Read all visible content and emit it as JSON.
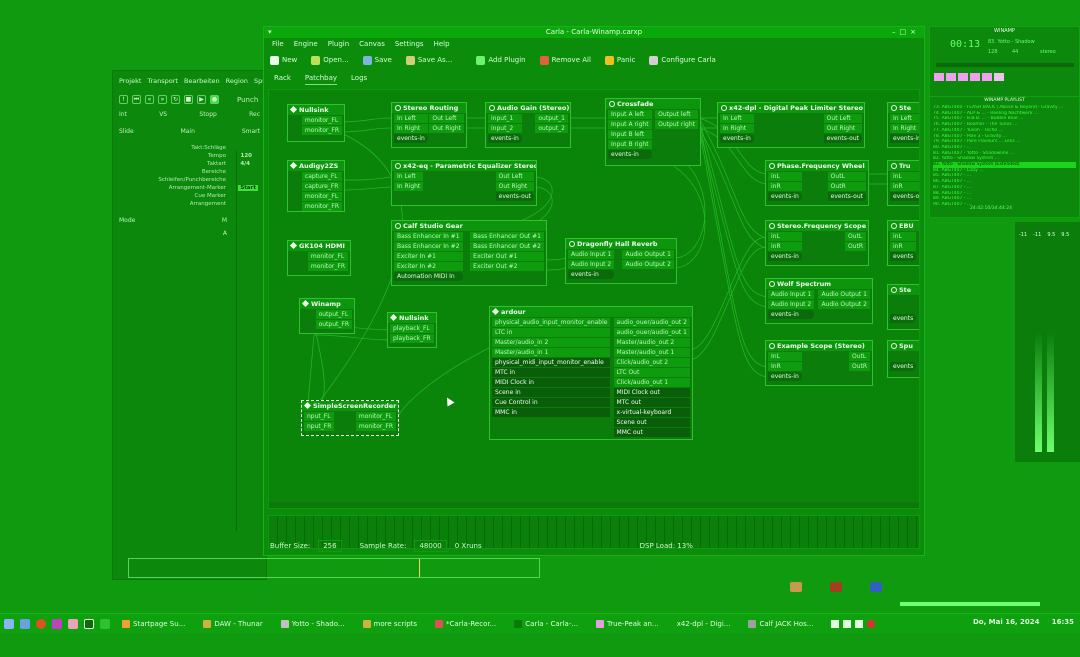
{
  "daw": {
    "menu": [
      "Projekt",
      "Transport",
      "Bearbeiten",
      "Region",
      "Spur"
    ],
    "punch_label": "Punch",
    "int_label": "Int",
    "vs_label": "VS",
    "stopp_label": "Stopp",
    "rec_label": "Rec",
    "slide_label": "Slide",
    "main_label": "Main",
    "smart_label": "Smart",
    "rulers": [
      "Takt:Schläge",
      "Tempo",
      "Taktart",
      "Bereiche",
      "Schleifen/Punchbereiche",
      "Arrangement-Marker",
      "Cue Marker",
      "Arrangement"
    ],
    "tempo_value": "120",
    "meter_value": "4/4",
    "start_label": "Start",
    "mode_label": "Mode",
    "m_label": "M",
    "a_label": "A"
  },
  "carla": {
    "title": "Carla - Carla-Winamp.carxp",
    "menu": [
      "File",
      "Engine",
      "Plugin",
      "Canvas",
      "Settings",
      "Help"
    ],
    "toolbar": [
      "New",
      "Open...",
      "Save",
      "Save As...",
      "Add Plugin",
      "Remove All",
      "Panic",
      "Configure Carla"
    ],
    "tabs": [
      "Rack",
      "Patchbay",
      "Logs"
    ],
    "status": {
      "buffer_label": "Buffer Size:",
      "buffer_value": "256",
      "rate_label": "Sample Rate:",
      "rate_value": "48000",
      "xruns": "0 Xruns",
      "dsp": "DSP Load: 13%"
    },
    "plugins": {
      "nullsink1": {
        "title": "Nullsink",
        "out": [
          "monitor_FL",
          "monitor_FR"
        ]
      },
      "stereo_routing": {
        "title": "Stereo Routing",
        "in": [
          "In Left",
          "In Right",
          "events-in"
        ],
        "out": [
          "Out Left",
          "Out Right"
        ]
      },
      "audio_gain": {
        "title": "Audio Gain (Stereo)",
        "in": [
          "input_1",
          "input_2",
          "events-in"
        ],
        "out": [
          "output_1",
          "output_2"
        ]
      },
      "crossfade": {
        "title": "Crossfade",
        "in": [
          "Input A left",
          "Input A right",
          "Input B left",
          "Input B right",
          "events-in"
        ],
        "out": [
          "Output left",
          "Output right"
        ]
      },
      "x42_dpl": {
        "title": "x42-dpl - Digital Peak Limiter Stereo",
        "in": [
          "In Left",
          "In Right",
          "events-in"
        ],
        "out": [
          "Out Left",
          "Out Right",
          "events-out"
        ]
      },
      "ste_cut": {
        "title": "Ste",
        "in": [
          "In Left",
          "In Right",
          "events-in"
        ]
      },
      "audigy": {
        "title": "Audigy2ZS",
        "out": [
          "capture_FL",
          "capture_FR",
          "monitor_FL",
          "monitor_FR"
        ]
      },
      "x42_eq": {
        "title": "x42-eq - Parametric Equalizer Stereo",
        "in": [
          "In Left",
          "In Right"
        ],
        "out": [
          "Out Left",
          "Out Right",
          "events-out"
        ]
      },
      "phase_wheel": {
        "title": "Phase.Frequency Wheel",
        "in": [
          "inL",
          "inR",
          "events-in"
        ],
        "out": [
          "OutL",
          "OutR",
          "events-out"
        ]
      },
      "tru_cut": {
        "title": "Tru",
        "in": [
          "inL",
          "inR",
          "events-o"
        ]
      },
      "calf_gear": {
        "title": "Calf Studio Gear",
        "in": [
          "Bass Enhancer In #1",
          "Bass Enhancer In #2",
          "Exciter In #1",
          "Exciter In #2",
          "Automation MIDI In"
        ],
        "out": [
          "Bass Enhancer Out #1",
          "Bass Enhancer Out #2",
          "Exciter Out #1",
          "Exciter Out #2"
        ]
      },
      "gk104": {
        "title": "GK104 HDMI",
        "out": [
          "monitor_FL",
          "monitor_FR"
        ]
      },
      "dragonfly": {
        "title": "Dragonfly Hall Reverb",
        "in": [
          "Audio Input 1",
          "Audio Input 2",
          "events-in"
        ],
        "out": [
          "Audio Output 1",
          "Audio Output 2"
        ]
      },
      "stereo_scope": {
        "title": "Stereo.Frequency Scope",
        "in": [
          "inL",
          "inR",
          "events-in"
        ],
        "out": [
          "OutL",
          "OutR"
        ]
      },
      "ebu_cut": {
        "title": "EBU",
        "in": [
          "inL",
          "inR",
          "events"
        ]
      },
      "wolf": {
        "title": "Wolf Spectrum",
        "in": [
          "Audio Input 1",
          "Audio Input 2",
          "events-in"
        ],
        "out": [
          "Audio Output 1",
          "Audio Output 2"
        ]
      },
      "ste2_cut": {
        "title": "Ste",
        "in": [
          "events"
        ]
      },
      "winamp": {
        "title": "Winamp",
        "out": [
          "output_FL",
          "output_FR"
        ]
      },
      "nullsink2": {
        "title": "Nullsink",
        "in": [
          "playback_FL",
          "playback_FR"
        ]
      },
      "ardour": {
        "title": "ardour",
        "in": [
          "physical_audio_input_monitor_enable",
          "LTC in",
          "Master/audio_in 2",
          "Master/audio_in 1",
          "physical_midi_input_monitor_enable",
          "MTC in",
          "MIDI Clock in",
          "Scene in",
          "Cue Control in",
          "MMC in"
        ],
        "out": [
          "audio_ouer/audio_out 2",
          "audio_ouer/audio_out 1",
          "Master/audio_out 2",
          "Master/audio_out 1",
          "Click/audio_out 2",
          "LTC Out",
          "Click/audio_out 1",
          "MIDI Clock out",
          "MTC out",
          "x-virtual-keyboard",
          "Scene out",
          "MMC out"
        ]
      },
      "example_scope": {
        "title": "Example Scope (Stereo)",
        "in": [
          "InL",
          "InR",
          "events-in"
        ],
        "out": [
          "OutL",
          "OutR"
        ]
      },
      "spu_cut": {
        "title": "Spu",
        "in": [
          "events"
        ]
      },
      "ssr": {
        "title": "SimpleScreenRecorder",
        "in": [
          "nput_FL",
          "nput_FR"
        ],
        "out": [
          "monitor_FL",
          "monitor_FR"
        ]
      }
    }
  },
  "winamp": {
    "title": "WINAMP",
    "time": "00:13",
    "track": "83. Yotto - Shadow",
    "kbps": "128",
    "khz": "44",
    "mono_stereo": "stereo",
    "playlist_title": "WINAMP PLAYLIST",
    "playlist": [
      "73. ABGT400 - FLASH BACK | Above & Beyond - Gravity ...",
      "74. ABGT407 - ALP & ... - Reeling Nachtwerk ...",
      "75. ABGT407 - B.B.B. ... - Bubble Blue ...",
      "76. ABGT407 - Boomer - The Tunes ...",
      "77. ABGT407 - Yusoh - Techo ...",
      "78. ABGT407 - Pole 3 - Gravity ...",
      "79. ABGT407 - Pure Flavours ... Lens ...",
      "80. ABGT407 - ...",
      "81. ABGT407 - Yotto - Shadowline ...",
      "82. Yotto - Shadow System ...",
      "83. Yotto - Shadow System (Extended)",
      "84. ABGT407 - Lizzy ...",
      "85. ABGT407 - ...",
      "86. ABGT407 - ...",
      "87. ABGT407 - ...",
      "88. ABGT407 - ...",
      "89. ABGT407 - ...",
      "90. ABGT407 - ..."
    ],
    "total": "24:42:10/34:44:24",
    "counter": "00:13"
  },
  "meters": {
    "labels": [
      "-11",
      "-11",
      "9.5",
      "9.5"
    ]
  },
  "taskbar": {
    "tasks": [
      "Startpage Su...",
      "DAW - Thunar",
      "Yotto - Shado...",
      "more scripts",
      "*Carla-Recor...",
      "Carla - Carla-...",
      "True-Peak an...",
      "x42-dpl - Digi...",
      "Calf JACK Hos..."
    ],
    "clock": "Do, Mai 16, 2024",
    "time": "16:35"
  },
  "colors": {
    "bg": "#0f9a0f",
    "accent": "#30c030"
  }
}
